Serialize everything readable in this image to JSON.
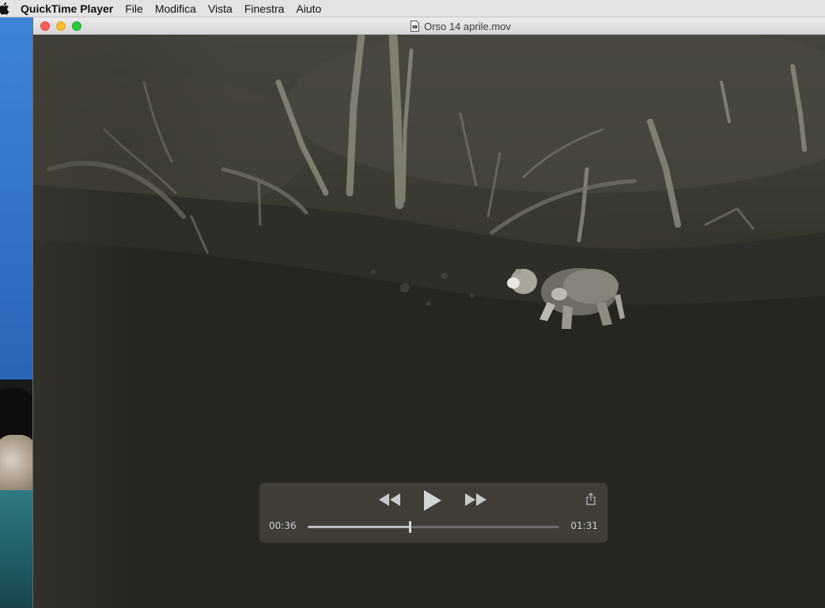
{
  "menubar": {
    "app_name": "QuickTime Player",
    "items": [
      "File",
      "Modifica",
      "Vista",
      "Finestra",
      "Aiuto"
    ]
  },
  "window": {
    "title": "Orso 14 aprile.mov"
  },
  "player": {
    "current_time": "00:36",
    "total_time": "01:31",
    "progress": 0.405
  },
  "icons": {
    "apple": "apple-logo-icon",
    "document": "movie-document-icon",
    "rewind": "rewind-icon",
    "play": "play-icon",
    "fast_forward": "fast-forward-icon",
    "share": "share-icon"
  },
  "colors": {
    "close": "#fe5f57",
    "minimize": "#febc2e",
    "maximize": "#28c840"
  }
}
